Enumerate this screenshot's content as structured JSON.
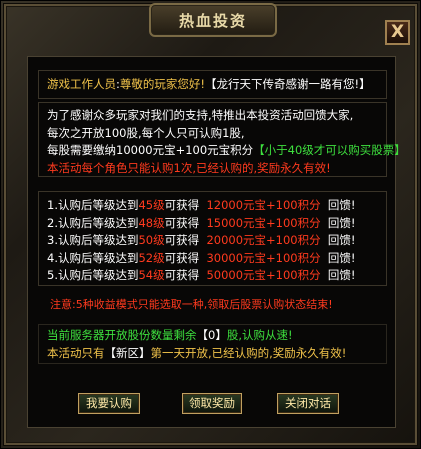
{
  "window": {
    "title": "热血投资",
    "close_label": "X"
  },
  "greeting": {
    "prefix": "游戏工作人员",
    "salute": "尊敬的玩家您好!",
    "thanks": "【龙行天下传奇感谢一路有您!】"
  },
  "intro": {
    "line1": "为了感谢众多玩家对我们的支持,特推出本投资活动回馈大家,",
    "line2": "每次之开放100股,每个人只可认购1股,",
    "line3": "每股需要缴纳10000元宝+100元宝积分",
    "line3_note": "【小于40级才可以购买股票】",
    "warning": "本活动每个角色只能认购1次,已经认购的,奖励永久有效!"
  },
  "rewards": [
    {
      "index": "1.",
      "pre": "认购后等级达到",
      "level": "45级",
      "mid": "可获得",
      "amount": "12000元宝+100积分",
      "post": "回馈!"
    },
    {
      "index": "2.",
      "pre": "认购后等级达到",
      "level": "48级",
      "mid": "可获得",
      "amount": "15000元宝+100积分",
      "post": "回馈!"
    },
    {
      "index": "3.",
      "pre": "认购后等级达到",
      "level": "50级",
      "mid": "可获得",
      "amount": "20000元宝+100积分",
      "post": "回馈!"
    },
    {
      "index": "4.",
      "pre": "认购后等级达到",
      "level": "52级",
      "mid": "可获得",
      "amount": "30000元宝+100积分",
      "post": "回馈!"
    },
    {
      "index": "5.",
      "pre": "认购后等级达到",
      "level": "54级",
      "mid": "可获得",
      "amount": "50000元宝+100积分",
      "post": "回馈!"
    }
  ],
  "note": "注意:5种收益模式只能选取一种,领取后股票认购状态结束!",
  "status": {
    "pre": "当前服务器开放股份数量剩余",
    "count": "【0】",
    "post": "股,认购从速!"
  },
  "newserver": {
    "pre": "本活动只有",
    "region": "【新区】",
    "post": "第一天开放,已经认购的,奖励永久有效!"
  },
  "buttons": {
    "buy": "我要认购",
    "claim": "领取奖励",
    "close": "关闭对话"
  },
  "colors": {
    "gold": "#f0c24a",
    "green": "#3ee03e",
    "red": "#ff3a1e",
    "white": "#ffffff"
  }
}
